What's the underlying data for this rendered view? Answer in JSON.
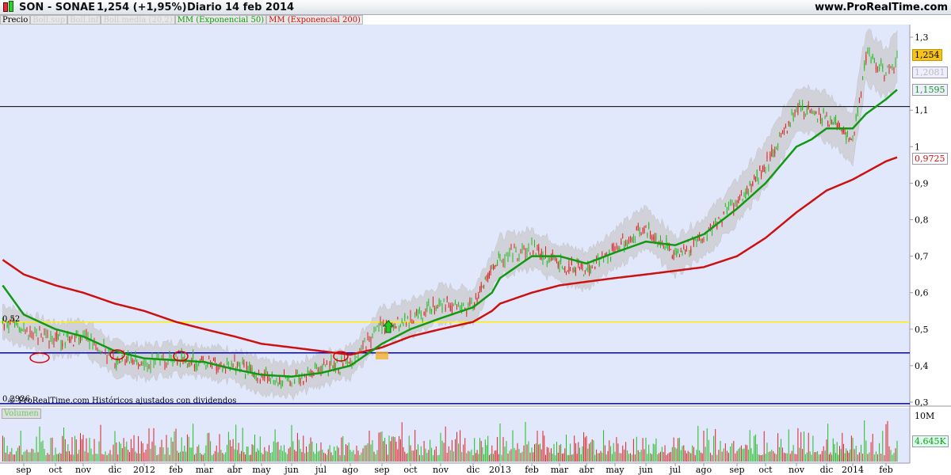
{
  "header": {
    "symbol": "SON - SONAE",
    "price": "1,254 (+1,95%)",
    "period": "Diario",
    "date": "14 feb 2014",
    "site": "www.ProRealTime.com"
  },
  "legend": [
    "Precio",
    "Boll.sup",
    "Boll.inf",
    "Boll.media (20,2)",
    "MM (Exponencial 50)",
    "MM (Exponencial 200)"
  ],
  "tags": {
    "last": "1,254",
    "boll": "1,2081",
    "ema50": "1,1595",
    "ema200": "0,9725",
    "vol": "4.645K",
    "vol_axis": "10M"
  },
  "labels": {
    "yellow": "0,52",
    "bottom": "0,2926",
    "footer": "© ProRealTime.com  Históricos ajustados con dividendos",
    "volume": "Volumen"
  },
  "colors": {
    "ema50": "#119911",
    "ema200": "#cc1111",
    "up": "#22bb22",
    "down": "#dd2222",
    "band": "#cfcfd4",
    "bg": "#e2e8fb"
  },
  "chart_data": {
    "type": "line",
    "title": "SON - SONAE",
    "ylim": [
      0.3,
      1.32
    ],
    "yticks": [
      "1,3",
      "1,1",
      "1",
      "0,9",
      "0,8",
      "0,7",
      "0,6",
      "0,5",
      "0,4",
      "0,3"
    ],
    "ytick_values": [
      1.3,
      1.1,
      1,
      0.9,
      0.8,
      0.7,
      0.6,
      0.5,
      0.4,
      0.3
    ],
    "categories": [
      "sep",
      "oct",
      "nov",
      "dic",
      "2012",
      "feb",
      "mar",
      "abr",
      "may",
      "jun",
      "jul",
      "ago",
      "sep",
      "oct",
      "nov",
      "dic",
      "2013",
      "feb",
      "mar",
      "abr",
      "may",
      "jun",
      "jul",
      "ago",
      "sep",
      "oct",
      "nov",
      "dic",
      "2014",
      "feb"
    ],
    "x": [
      -0.7,
      0,
      1,
      2,
      3,
      4,
      5,
      6,
      7,
      8,
      9,
      10,
      11,
      12,
      13,
      14,
      15,
      15.7,
      16,
      17,
      18,
      19,
      20,
      21,
      22,
      23,
      24,
      25,
      26,
      26.5,
      27,
      28,
      28.4,
      29,
      29.4
    ],
    "series": [
      {
        "name": "Precio",
        "values": [
          0.52,
          0.5,
          0.47,
          0.48,
          0.42,
          0.41,
          0.42,
          0.41,
          0.4,
          0.37,
          0.36,
          0.39,
          0.41,
          0.51,
          0.53,
          0.57,
          0.56,
          0.66,
          0.7,
          0.72,
          0.68,
          0.66,
          0.72,
          0.78,
          0.7,
          0.75,
          0.85,
          0.95,
          1.1,
          1.1,
          1.08,
          1.02,
          1.25,
          1.2,
          1.254
        ]
      },
      {
        "name": "MM (Exponencial 50)",
        "values": [
          0.62,
          0.54,
          0.5,
          0.48,
          0.44,
          0.42,
          0.415,
          0.41,
          0.39,
          0.375,
          0.37,
          0.38,
          0.4,
          0.46,
          0.5,
          0.53,
          0.56,
          0.6,
          0.64,
          0.7,
          0.7,
          0.68,
          0.71,
          0.74,
          0.73,
          0.76,
          0.83,
          0.9,
          1.0,
          1.02,
          1.05,
          1.05,
          1.09,
          1.13,
          1.16
        ]
      },
      {
        "name": "MM (Exponencial 200)",
        "values": [
          0.69,
          0.65,
          0.62,
          0.6,
          0.57,
          0.55,
          0.52,
          0.5,
          0.48,
          0.46,
          0.45,
          0.44,
          0.43,
          0.45,
          0.48,
          0.5,
          0.52,
          0.55,
          0.57,
          0.6,
          0.62,
          0.63,
          0.64,
          0.65,
          0.66,
          0.67,
          0.7,
          0.75,
          0.82,
          0.85,
          0.88,
          0.91,
          0.93,
          0.96,
          0.9725
        ]
      }
    ],
    "hlines": [
      1.11,
      0.52,
      0.435,
      0.296
    ]
  }
}
